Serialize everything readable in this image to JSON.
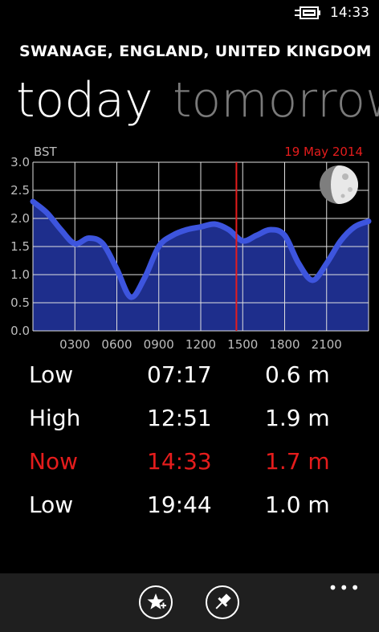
{
  "status": {
    "time": "14:33"
  },
  "header": {
    "location": "SWANAGE, ENGLAND, UNITED KINGDOM"
  },
  "pivot": {
    "tabs": [
      "today",
      "tomorrow"
    ]
  },
  "chart_data": {
    "type": "area",
    "timezone_label": "BST",
    "date_label": "19 May 2014",
    "x": [
      0,
      1,
      2,
      3,
      4,
      5,
      6,
      7,
      8,
      9,
      10,
      11,
      12,
      13,
      14,
      15,
      16,
      17,
      18,
      19,
      20,
      21,
      22,
      23,
      24
    ],
    "values": [
      2.3,
      2.1,
      1.8,
      1.55,
      1.65,
      1.55,
      1.1,
      0.6,
      0.95,
      1.5,
      1.7,
      1.8,
      1.85,
      1.9,
      1.8,
      1.6,
      1.7,
      1.8,
      1.7,
      1.2,
      0.9,
      1.2,
      1.6,
      1.85,
      1.95
    ],
    "x_tick_labels": [
      "0300",
      "0600",
      "0900",
      "1200",
      "1500",
      "1800",
      "2100"
    ],
    "x_ticks": [
      3,
      6,
      9,
      12,
      15,
      18,
      21
    ],
    "y_tick_labels": [
      "0.0",
      "0.5",
      "1.0",
      "1.5",
      "2.0",
      "2.5",
      "3.0"
    ],
    "ylim": [
      0,
      3.0
    ],
    "xlim": [
      0,
      24
    ],
    "now_marker": 14.55,
    "grid": true,
    "colors": {
      "fill": "#1e2e8c",
      "line": "#3d55de",
      "now": "#e51c1c",
      "grid": "#e0e0e0",
      "axis_text": "#bdbdbd"
    }
  },
  "tides": [
    {
      "type": "Low",
      "time": "07:17",
      "height": "0.6 m"
    },
    {
      "type": "High",
      "time": "12:51",
      "height": "1.9 m"
    },
    {
      "type": "Now",
      "time": "14:33",
      "height": "1.7 m",
      "highlight": true
    },
    {
      "type": "Low",
      "time": "19:44",
      "height": "1.0 m"
    }
  ],
  "appbar": {
    "more": "•••",
    "buttons": [
      "add-favorite-icon",
      "pin-icon"
    ]
  }
}
